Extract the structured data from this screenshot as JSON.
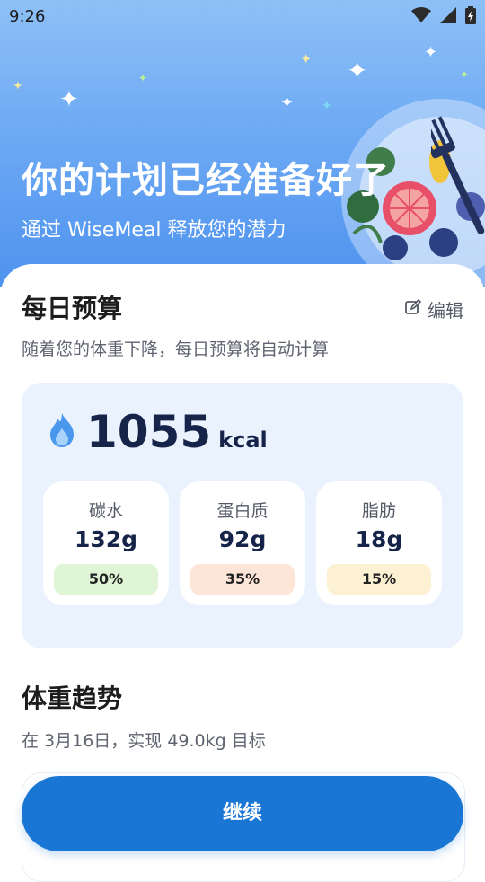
{
  "status": {
    "time": "9:26"
  },
  "hero": {
    "title": "你的计划已经准备好了",
    "subtitle": "通过 WiseMeal 释放您的潜力"
  },
  "budget": {
    "title": "每日预算",
    "edit_label": "编辑",
    "subtitle": "随着您的体重下降，每日预算将自动计算",
    "calories": "1055",
    "calorie_unit": "kcal",
    "macros": [
      {
        "name": "碳水",
        "value": "132g",
        "percent": "50%",
        "color": "#dff5d6"
      },
      {
        "name": "蛋白质",
        "value": "92g",
        "percent": "35%",
        "color": "#fde5d8"
      },
      {
        "name": "脂肪",
        "value": "18g",
        "percent": "15%",
        "color": "#fdf1d3"
      }
    ]
  },
  "trend": {
    "title": "体重趋势",
    "subtitle": "在 3月16日，实现 49.0kg 目标"
  },
  "continue_label": "继续",
  "colors": {
    "primary": "#1a76d5",
    "card_bg": "#e9f2fd",
    "dark_text": "#17244a"
  },
  "icons": {
    "edit": "edit-icon",
    "flame": "flame-icon",
    "wifi": "wifi-icon",
    "signal": "signal-icon",
    "battery": "battery-icon"
  }
}
